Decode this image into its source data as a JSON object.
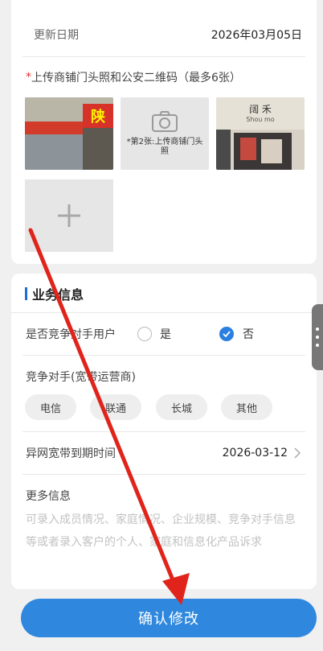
{
  "card1": {
    "update_label": "更新日期",
    "update_value": "2026年03月05日",
    "upload_required": "*",
    "upload_label": "上传商铺门头照和公安二维码（最多6张）",
    "photo2_caption": "*第2张:上传商铺门头照",
    "photo1_sign": "陕",
    "photo3_sign": "阔 禾",
    "photo3_subsign": "Shou mo"
  },
  "card2": {
    "section_title": "业务信息",
    "competitor_user_label": "是否竞争对手用户",
    "yes_label": "是",
    "no_label": "否",
    "competitor_label": "竞争对手(宽带运营商)",
    "chips": [
      "电信",
      "联通",
      "长城",
      "其他"
    ],
    "expiry_label": "异网宽带到期时间",
    "expiry_value": "2026-03-12",
    "more_info_label": "更多信息",
    "more_info_placeholder": "可录入成员情况、家庭情况、企业规模、竞争对手信息等或者录入客户的个人、家庭和信息化产品诉求"
  },
  "submit_label": "确认修改",
  "colors": {
    "accent": "#2f88de",
    "annotation_arrow": "#e0241b"
  }
}
